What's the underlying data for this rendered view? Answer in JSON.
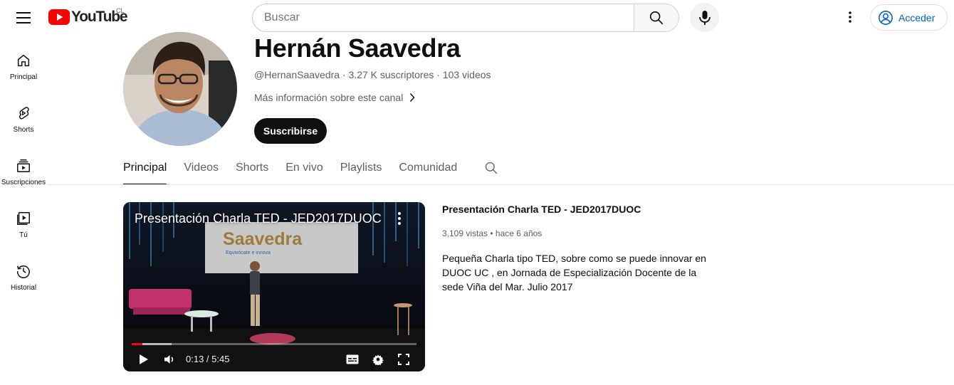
{
  "header": {
    "logo_text": "YouTube",
    "country_code": "CL",
    "search_placeholder": "Buscar",
    "signin_label": "Acceder",
    "icons": [
      "menu-icon",
      "youtube-logo-icon",
      "search-icon",
      "mic-icon",
      "more-vert-icon",
      "account-circle-icon"
    ]
  },
  "sidebar": {
    "items": [
      {
        "label": "Principal",
        "icon": "home-icon"
      },
      {
        "label": "Shorts",
        "icon": "shorts-icon"
      },
      {
        "label": "Suscripciones",
        "icon": "subscriptions-icon"
      },
      {
        "label": "Tú",
        "icon": "library-icon"
      },
      {
        "label": "Historial",
        "icon": "history-icon"
      }
    ]
  },
  "channel": {
    "name": "Hernán Saavedra",
    "handle": "@HernanSaavedra",
    "subscribers": "3.27 K suscriptores",
    "videos": "103 videos",
    "separator": " · ",
    "more_info": "Más información sobre este canal",
    "subscribe_label": "Suscribirse"
  },
  "tabs": [
    {
      "label": "Principal",
      "active": true
    },
    {
      "label": "Videos",
      "active": false
    },
    {
      "label": "Shorts",
      "active": false
    },
    {
      "label": "En vivo",
      "active": false
    },
    {
      "label": "Playlists",
      "active": false
    },
    {
      "label": "Comunidad",
      "active": false
    }
  ],
  "featured_video": {
    "title": "Presentación Charla TED - JED2017DUOC",
    "player_title": "Presentación Charla TED - JED2017DUOC",
    "slide_text": "Saavedra",
    "slide_subtext": "Equivócate e innova",
    "current_time": "0:13",
    "duration": "5:45",
    "time_display": "0:13 / 5:45",
    "progress_played_fraction": 0.038,
    "progress_buffered_fraction": 0.14,
    "views": "3,109 vistas",
    "age": "hace 6 años",
    "stats_separator": " • ",
    "description": "Pequeña Charla tipo TED, sobre como se puede innovar en DUOC UC , en Jornada de Especialización Docente de la sede Viña del Mar. Julio 2017"
  },
  "colors": {
    "brand_red": "#ff0000",
    "link_blue": "#065fd4",
    "text_primary": "#0f0f0f",
    "text_secondary": "#606060"
  }
}
